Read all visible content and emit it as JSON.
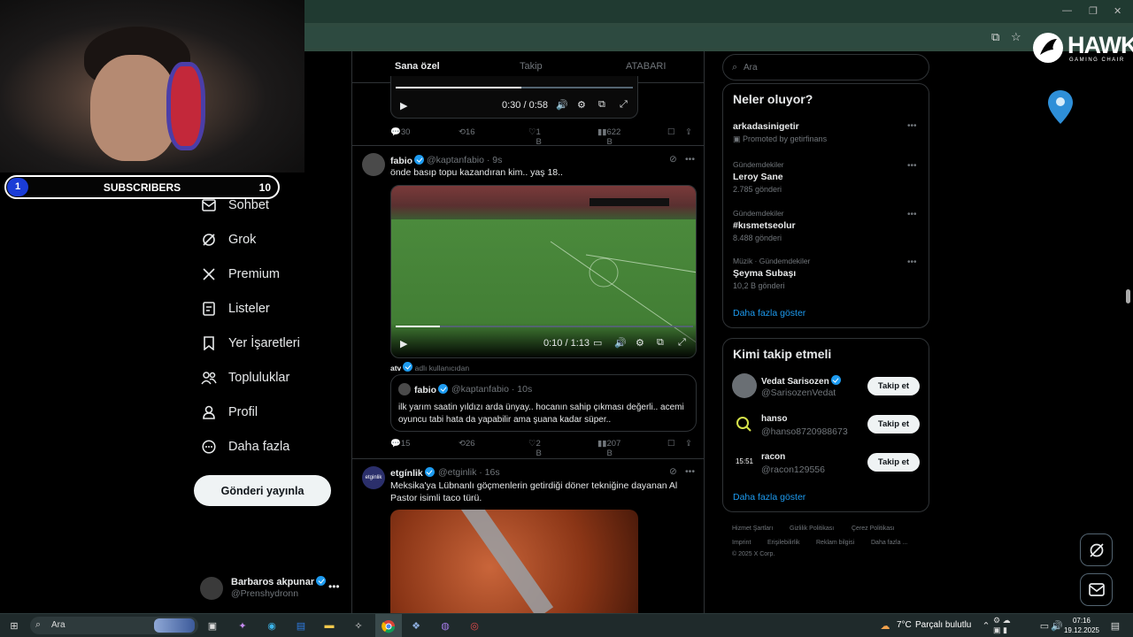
{
  "overlay": {
    "subscribers": {
      "level": "1",
      "label": "SUBSCRIBERS",
      "count": "10"
    },
    "logo": {
      "brand": "HAWK",
      "tagline": "GAMING CHAIR"
    }
  },
  "nav": {
    "items": [
      {
        "label": "Sohbet",
        "icon": "mail-icon"
      },
      {
        "label": "Grok",
        "icon": "grok-icon"
      },
      {
        "label": "Premium",
        "icon": "x-logo-icon"
      },
      {
        "label": "Listeler",
        "icon": "list-icon"
      },
      {
        "label": "Yer İşaretleri",
        "icon": "bookmark-icon"
      },
      {
        "label": "Topluluklar",
        "icon": "communities-icon"
      },
      {
        "label": "Profil",
        "icon": "profile-icon"
      },
      {
        "label": "Daha fazla",
        "icon": "more-circle-icon"
      }
    ],
    "post_button": "Gönderi yayınla",
    "account": {
      "name": "Barbaros akpunar",
      "handle": "@Prenshydronn"
    }
  },
  "feed": {
    "tabs": [
      "Sana özel",
      "Takip",
      "ATABARI"
    ],
    "tweet0": {
      "time": "0:30 / 0:58",
      "progress": 0.53,
      "stats": {
        "replies": "30",
        "reposts": "16",
        "likes": "1 B",
        "views": "622 B"
      }
    },
    "tweet1": {
      "name": "fabio",
      "handle": "@kaptanfabio",
      "age": "· 9s",
      "text": "önde basıp topu kazandıran kim.. yaş 18..",
      "video_time": "0:10 / 1:13",
      "progress": 0.15,
      "credit_name": "atv",
      "credit_text": "adlı kullanıcıdan",
      "quote": {
        "name": "fabio",
        "handle": "@kaptanfabio",
        "age": "· 10s",
        "text": "ilk yarım saatin yıldızı arda ünyay.. hocanın sahip çıkması değerli.. acemi oyuncu tabi hata da yapabilir ama şuana kadar süper.."
      },
      "stats": {
        "replies": "15",
        "reposts": "26",
        "likes": "2 B",
        "views": "207 B"
      }
    },
    "tweet2": {
      "name": "etgínlik",
      "handle": "@etginlik",
      "age": "· 16s",
      "avatar_text": "etginlik",
      "text": "Meksika'ya Lübnanlı göçmenlerin getirdiği döner tekniğine dayanan Al Pastor isimli taco türü."
    }
  },
  "sidebar": {
    "search_placeholder": "Ara",
    "trends_title": "Neler oluyor?",
    "trends": [
      {
        "category": "",
        "name": "arkadasinigetir",
        "sub": "Promoted by getirfinans"
      },
      {
        "category": "Gündemdekiler",
        "name": "Leroy Sane",
        "sub": "2.785 gönderi"
      },
      {
        "category": "Gündemdekiler",
        "name": "#kısmetseolur",
        "sub": "8.488 gönderi"
      },
      {
        "category": "Müzik · Gündemdekiler",
        "name": "Şeyma Subaşı",
        "sub": "10,2 B gönderi"
      }
    ],
    "show_more": "Daha fazla göster",
    "who_title": "Kimi takip etmeli",
    "who": [
      {
        "name": "Vedat Sarisozen",
        "handle": "@SarisozenVedat",
        "button": "Takip et"
      },
      {
        "name": "hanso",
        "handle": "@hanso8720988673",
        "button": "Takip et"
      },
      {
        "name": "racon",
        "handle": "@racon129556",
        "button": "Takip et",
        "avatar_text": "15:51"
      }
    ],
    "who_more": "Daha fazla göster",
    "footer": [
      "Hizmet Şartları",
      "Gizlilik Politikası",
      "Çerez Politikası",
      "Imprint",
      "Erişilebilirlik",
      "Reklam bilgisi",
      "Daha fazla ...",
      "© 2025 X Corp."
    ]
  },
  "taskbar": {
    "search": "Ara",
    "weather_temp": "7°C",
    "weather_text": "Parçalı bulutlu",
    "time": "07:16",
    "date": "19.12.2025"
  }
}
